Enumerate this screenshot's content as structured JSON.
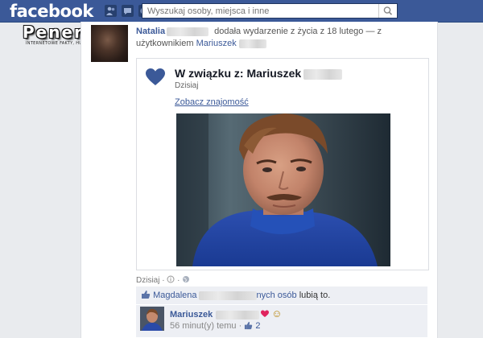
{
  "header": {
    "logo": "facebook",
    "search_placeholder": "Wyszukaj osoby, miejsca i inne"
  },
  "watermark": {
    "main": "Penera.pl",
    "sub": "INTERNETOWE FAKTY, HUMOR, OBRAZKI"
  },
  "story": {
    "author": "Natalia",
    "action": "dodała wydarzenie z życia z 18 lutego — z użytkownikiem",
    "tagged_user": "Mariuszek",
    "card": {
      "title": "W związku z: Mariuszek",
      "date": "Dzisiaj",
      "link": "Zobacz znajomość"
    },
    "meta_time": "Dzisiaj",
    "likes": {
      "first_name": "Magdalena",
      "others_link": "nych osób",
      "suffix": "lubią to."
    },
    "comment": {
      "author": "Mariuszek",
      "emoji": "☺",
      "time": "56 minut(y) temu",
      "like_count": "2"
    }
  }
}
